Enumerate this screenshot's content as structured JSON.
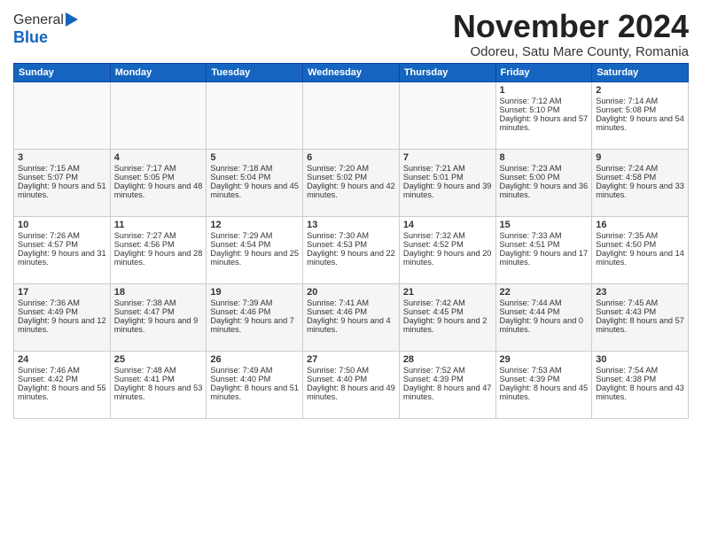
{
  "header": {
    "logo_line1": "General",
    "logo_line2": "Blue",
    "month_title": "November 2024",
    "subtitle": "Odoreu, Satu Mare County, Romania"
  },
  "days_of_week": [
    "Sunday",
    "Monday",
    "Tuesday",
    "Wednesday",
    "Thursday",
    "Friday",
    "Saturday"
  ],
  "weeks": [
    [
      {
        "day": "",
        "info": ""
      },
      {
        "day": "",
        "info": ""
      },
      {
        "day": "",
        "info": ""
      },
      {
        "day": "",
        "info": ""
      },
      {
        "day": "",
        "info": ""
      },
      {
        "day": "1",
        "info": "Sunrise: 7:12 AM\nSunset: 5:10 PM\nDaylight: 9 hours and 57 minutes."
      },
      {
        "day": "2",
        "info": "Sunrise: 7:14 AM\nSunset: 5:08 PM\nDaylight: 9 hours and 54 minutes."
      }
    ],
    [
      {
        "day": "3",
        "info": "Sunrise: 7:15 AM\nSunset: 5:07 PM\nDaylight: 9 hours and 51 minutes."
      },
      {
        "day": "4",
        "info": "Sunrise: 7:17 AM\nSunset: 5:05 PM\nDaylight: 9 hours and 48 minutes."
      },
      {
        "day": "5",
        "info": "Sunrise: 7:18 AM\nSunset: 5:04 PM\nDaylight: 9 hours and 45 minutes."
      },
      {
        "day": "6",
        "info": "Sunrise: 7:20 AM\nSunset: 5:02 PM\nDaylight: 9 hours and 42 minutes."
      },
      {
        "day": "7",
        "info": "Sunrise: 7:21 AM\nSunset: 5:01 PM\nDaylight: 9 hours and 39 minutes."
      },
      {
        "day": "8",
        "info": "Sunrise: 7:23 AM\nSunset: 5:00 PM\nDaylight: 9 hours and 36 minutes."
      },
      {
        "day": "9",
        "info": "Sunrise: 7:24 AM\nSunset: 4:58 PM\nDaylight: 9 hours and 33 minutes."
      }
    ],
    [
      {
        "day": "10",
        "info": "Sunrise: 7:26 AM\nSunset: 4:57 PM\nDaylight: 9 hours and 31 minutes."
      },
      {
        "day": "11",
        "info": "Sunrise: 7:27 AM\nSunset: 4:56 PM\nDaylight: 9 hours and 28 minutes."
      },
      {
        "day": "12",
        "info": "Sunrise: 7:29 AM\nSunset: 4:54 PM\nDaylight: 9 hours and 25 minutes."
      },
      {
        "day": "13",
        "info": "Sunrise: 7:30 AM\nSunset: 4:53 PM\nDaylight: 9 hours and 22 minutes."
      },
      {
        "day": "14",
        "info": "Sunrise: 7:32 AM\nSunset: 4:52 PM\nDaylight: 9 hours and 20 minutes."
      },
      {
        "day": "15",
        "info": "Sunrise: 7:33 AM\nSunset: 4:51 PM\nDaylight: 9 hours and 17 minutes."
      },
      {
        "day": "16",
        "info": "Sunrise: 7:35 AM\nSunset: 4:50 PM\nDaylight: 9 hours and 14 minutes."
      }
    ],
    [
      {
        "day": "17",
        "info": "Sunrise: 7:36 AM\nSunset: 4:49 PM\nDaylight: 9 hours and 12 minutes."
      },
      {
        "day": "18",
        "info": "Sunrise: 7:38 AM\nSunset: 4:47 PM\nDaylight: 9 hours and 9 minutes."
      },
      {
        "day": "19",
        "info": "Sunrise: 7:39 AM\nSunset: 4:46 PM\nDaylight: 9 hours and 7 minutes."
      },
      {
        "day": "20",
        "info": "Sunrise: 7:41 AM\nSunset: 4:46 PM\nDaylight: 9 hours and 4 minutes."
      },
      {
        "day": "21",
        "info": "Sunrise: 7:42 AM\nSunset: 4:45 PM\nDaylight: 9 hours and 2 minutes."
      },
      {
        "day": "22",
        "info": "Sunrise: 7:44 AM\nSunset: 4:44 PM\nDaylight: 9 hours and 0 minutes."
      },
      {
        "day": "23",
        "info": "Sunrise: 7:45 AM\nSunset: 4:43 PM\nDaylight: 8 hours and 57 minutes."
      }
    ],
    [
      {
        "day": "24",
        "info": "Sunrise: 7:46 AM\nSunset: 4:42 PM\nDaylight: 8 hours and 55 minutes."
      },
      {
        "day": "25",
        "info": "Sunrise: 7:48 AM\nSunset: 4:41 PM\nDaylight: 8 hours and 53 minutes."
      },
      {
        "day": "26",
        "info": "Sunrise: 7:49 AM\nSunset: 4:40 PM\nDaylight: 8 hours and 51 minutes."
      },
      {
        "day": "27",
        "info": "Sunrise: 7:50 AM\nSunset: 4:40 PM\nDaylight: 8 hours and 49 minutes."
      },
      {
        "day": "28",
        "info": "Sunrise: 7:52 AM\nSunset: 4:39 PM\nDaylight: 8 hours and 47 minutes."
      },
      {
        "day": "29",
        "info": "Sunrise: 7:53 AM\nSunset: 4:39 PM\nDaylight: 8 hours and 45 minutes."
      },
      {
        "day": "30",
        "info": "Sunrise: 7:54 AM\nSunset: 4:38 PM\nDaylight: 8 hours and 43 minutes."
      }
    ]
  ]
}
